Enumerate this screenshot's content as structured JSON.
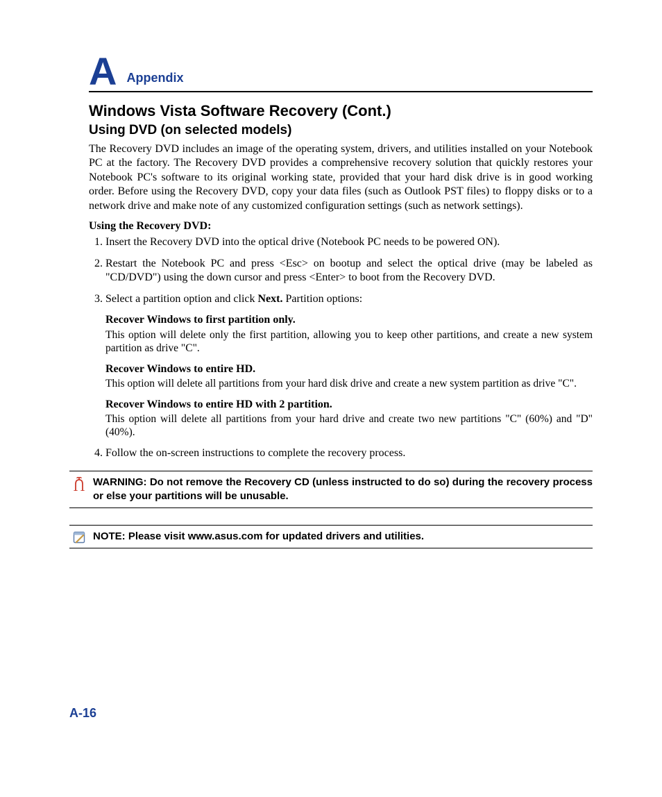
{
  "header": {
    "letter": "A",
    "word": "Appendix"
  },
  "title": "Windows Vista Software Recovery (Cont.)",
  "subtitle": "Using DVD (on selected models)",
  "intro": "The Recovery DVD includes an image of the operating system, drivers, and utilities installed on your Notebook PC at the factory. The Recovery DVD provides a comprehensive recovery solution that quickly restores your Notebook PC's software to its original working state, provided that your hard disk drive is in good working order. Before using the Recovery DVD, copy your data files (such as Outlook PST files) to floppy disks or to a network drive and make note of any customized configuration settings (such as network settings).",
  "list_heading": "Using the Recovery DVD:",
  "steps": {
    "s1": "Insert the Recovery DVD into the optical drive (Notebook PC needs to be powered ON).",
    "s2": "Restart the Notebook PC and press <Esc> on bootup and select the optical drive (may be labeled as \"CD/DVD\") using the down cursor and press <Enter> to boot from the Recovery DVD.",
    "s3_pre": "Select a partition option and click ",
    "s3_bold": "Next.",
    "s3_post": " Partition options:",
    "opts": {
      "o1": {
        "title": "Recover Windows to first partition only.",
        "desc": "This option will delete only the first partition, allowing you to keep other partitions, and create a new system partition as drive \"C\"."
      },
      "o2": {
        "title": "Recover Windows to entire HD.",
        "desc": "This option will delete all partitions from your hard disk drive and create a new system partition as drive \"C\"."
      },
      "o3": {
        "title": "Recover Windows to entire HD with 2 partition.",
        "desc": "This option will delete all partitions from your hard drive and create two new partitions \"C\" (60%) and \"D\" (40%)."
      }
    },
    "s4": "Follow the on-screen instructions to complete the recovery process."
  },
  "warning": "WARNING: Do not remove the Recovery CD (unless instructed to do so) during the recovery process or else your partitions will be unusable.",
  "note": "NOTE: Please visit www.asus.com for updated drivers and utilities.",
  "page_number": "A-16",
  "colors": {
    "accent": "#1b3f94",
    "warn": "#cc3a2b"
  }
}
